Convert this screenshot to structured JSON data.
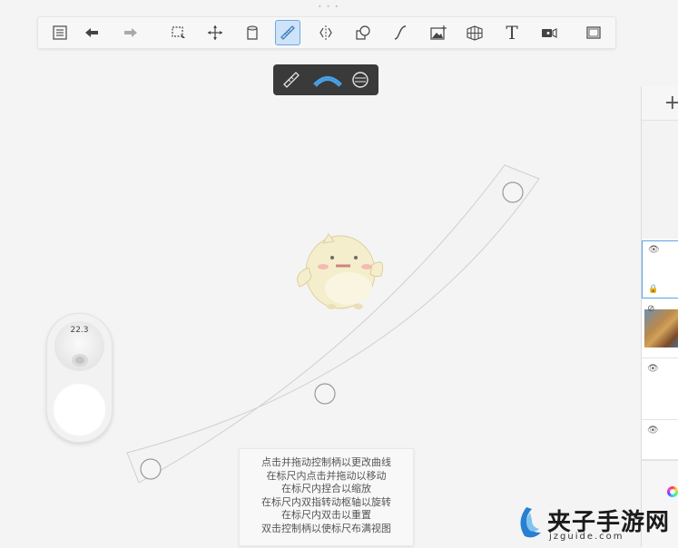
{
  "toolbar": {
    "items": [
      {
        "name": "gallery-list-icon"
      },
      {
        "name": "undo-icon"
      },
      {
        "name": "redo-icon"
      },
      {
        "name": "selection-icon"
      },
      {
        "name": "transform-icon"
      },
      {
        "name": "fill-icon"
      },
      {
        "name": "ruler-icon"
      },
      {
        "name": "symmetry-icon"
      },
      {
        "name": "shapes-icon"
      },
      {
        "name": "steady-stroke-icon"
      },
      {
        "name": "import-image-icon"
      },
      {
        "name": "perspective-guide-icon"
      },
      {
        "name": "text-icon",
        "label": "T"
      },
      {
        "name": "time-lapse-icon"
      },
      {
        "name": "fullscreen-icon"
      }
    ],
    "active_item": "ruler-icon"
  },
  "ruler_subbar": {
    "items": [
      "straight-ruler-icon",
      "french-curve-icon",
      "ellipse-guide-icon"
    ],
    "active_item": "french-curve-icon",
    "active_color": "#4aa3e8"
  },
  "brush_widget": {
    "size_value": "22.3"
  },
  "hint_box": {
    "lines": [
      "点击并拖动控制柄以更改曲线",
      "在标尺内点击并拖动以移动",
      "在标尺内捏合以缩放",
      "在标尺内双指转动枢轴以旋转",
      "在标尺内双击以重置",
      "双击控制柄以使标尺布满视图"
    ]
  },
  "layers_panel": {
    "add_label": "+",
    "layers": [
      {
        "visible": true,
        "selected": true,
        "locked": true,
        "has_thumbnail": false
      },
      {
        "visible": false,
        "selected": false,
        "locked": false,
        "has_thumbnail": true
      },
      {
        "visible": true,
        "selected": false,
        "locked": false,
        "has_thumbnail": false
      },
      {
        "visible": true,
        "selected": false,
        "locked": false,
        "has_thumbnail": false
      }
    ]
  },
  "watermark": {
    "title": "夹子手游网",
    "url": "jzguide.com"
  },
  "colors": {
    "accent": "#4aa3e8",
    "subbar_bg": "#3a3a3a",
    "canvas_bg": "#f4f4f4"
  }
}
